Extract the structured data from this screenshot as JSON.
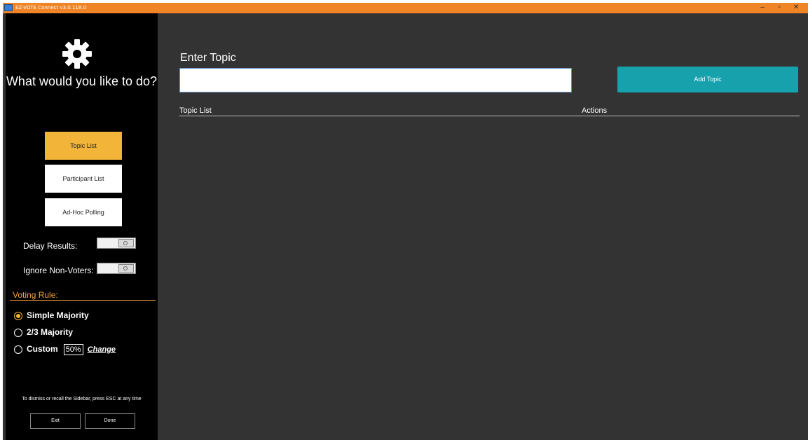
{
  "window": {
    "title": "EZ-VOTE Connect v3.0.118.0",
    "controls": [
      "–",
      "▫",
      "✕"
    ]
  },
  "sidebar": {
    "prompt": "What would you like to do?",
    "nav": {
      "topic_list": "Topic List",
      "participant_list": "Participant List",
      "adhoc_polling": "Ad-Hoc Polling"
    },
    "settings": {
      "delay_results": "Delay Results:",
      "ignore_non_voters": "Ignore Non-Voters:"
    },
    "voting_rule": {
      "title": "Voting Rule:",
      "simple": "Simple Majority",
      "two_thirds": "2/3 Majority",
      "custom": "Custom",
      "custom_value": "50%",
      "change": "Change"
    },
    "hint": "To dismiss or recall the Sidebar, press ESC at any time",
    "exit": "Exit",
    "done": "Done"
  },
  "main": {
    "title": "Enter Topic",
    "input_value": "",
    "add_button": "Add Topic",
    "columns": {
      "topic_list": "Topic List",
      "actions": "Actions"
    }
  },
  "colors": {
    "title_bar": "#f08528",
    "accent_active": "#f2b53a",
    "add_button": "#17a1ad",
    "background": "#333333"
  }
}
